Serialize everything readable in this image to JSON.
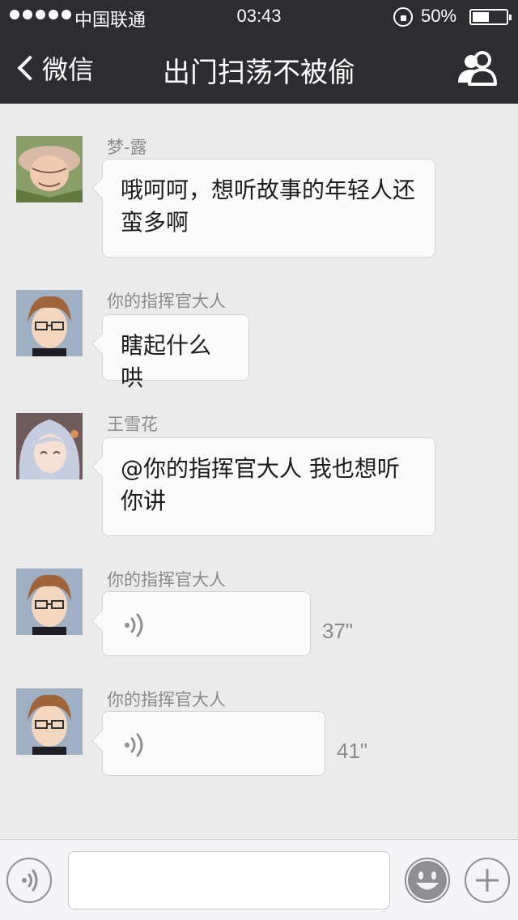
{
  "status_bar": {
    "carrier": "中国联通",
    "time": "03:43",
    "battery": "50%",
    "battery_level": 0.5,
    "signal_dots": 5
  },
  "nav": {
    "back_label": "微信",
    "title": "出门扫荡不被偷",
    "right_icon": "group-members-icon"
  },
  "messages": [
    {
      "sender": "梦-露",
      "type": "text",
      "text": "哦呵呵，想听故事的年轻人还\n蛮多啊"
    },
    {
      "sender": "你的指挥官大人",
      "type": "text",
      "text": "瞎起什么哄"
    },
    {
      "sender": "王雪花",
      "type": "text",
      "text": "@你的指挥官大人 我也想听\n你讲"
    },
    {
      "sender": "你的指挥官大人",
      "type": "voice",
      "duration": "37\""
    },
    {
      "sender": "你的指挥官大人",
      "type": "voice",
      "duration": "41\""
    }
  ],
  "input_bar": {
    "voice_icon": "voice-toggle-icon",
    "input_value": "",
    "emoji_icon": "emoji-icon",
    "plus_icon": "plus-icon"
  },
  "colors": {
    "nav_bg": "#2d2d31",
    "chat_bg": "#ebebeb",
    "bubble_bg": "#fafafa",
    "sender_text": "#8a8a8a"
  }
}
